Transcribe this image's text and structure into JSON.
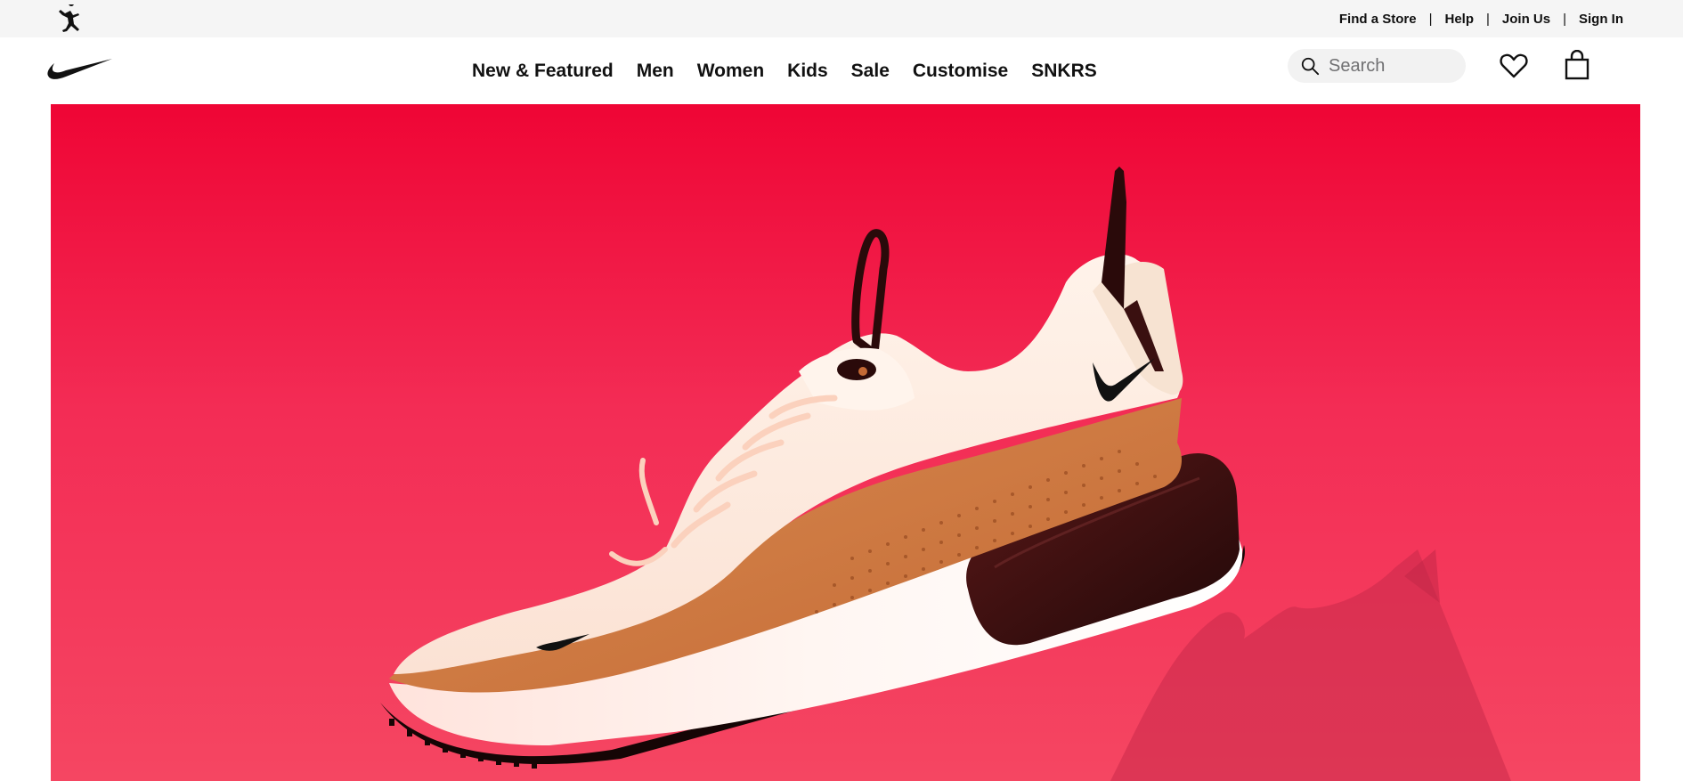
{
  "utility": {
    "links": [
      "Find a Store",
      "Help",
      "Join Us",
      "Sign In"
    ],
    "separator": "|"
  },
  "nav": {
    "items": [
      "New & Featured",
      "Men",
      "Women",
      "Kids",
      "Sale",
      "Customise",
      "SNKRS"
    ]
  },
  "search": {
    "placeholder": "Search"
  },
  "icons": {
    "jordan": "jumpman-logo-icon",
    "nike": "swoosh-logo-icon",
    "search": "search-icon",
    "favorites": "heart-icon",
    "bag": "shopping-bag-icon"
  },
  "hero": {
    "background_top": "#ef0535",
    "background_bottom": "#f54662"
  }
}
